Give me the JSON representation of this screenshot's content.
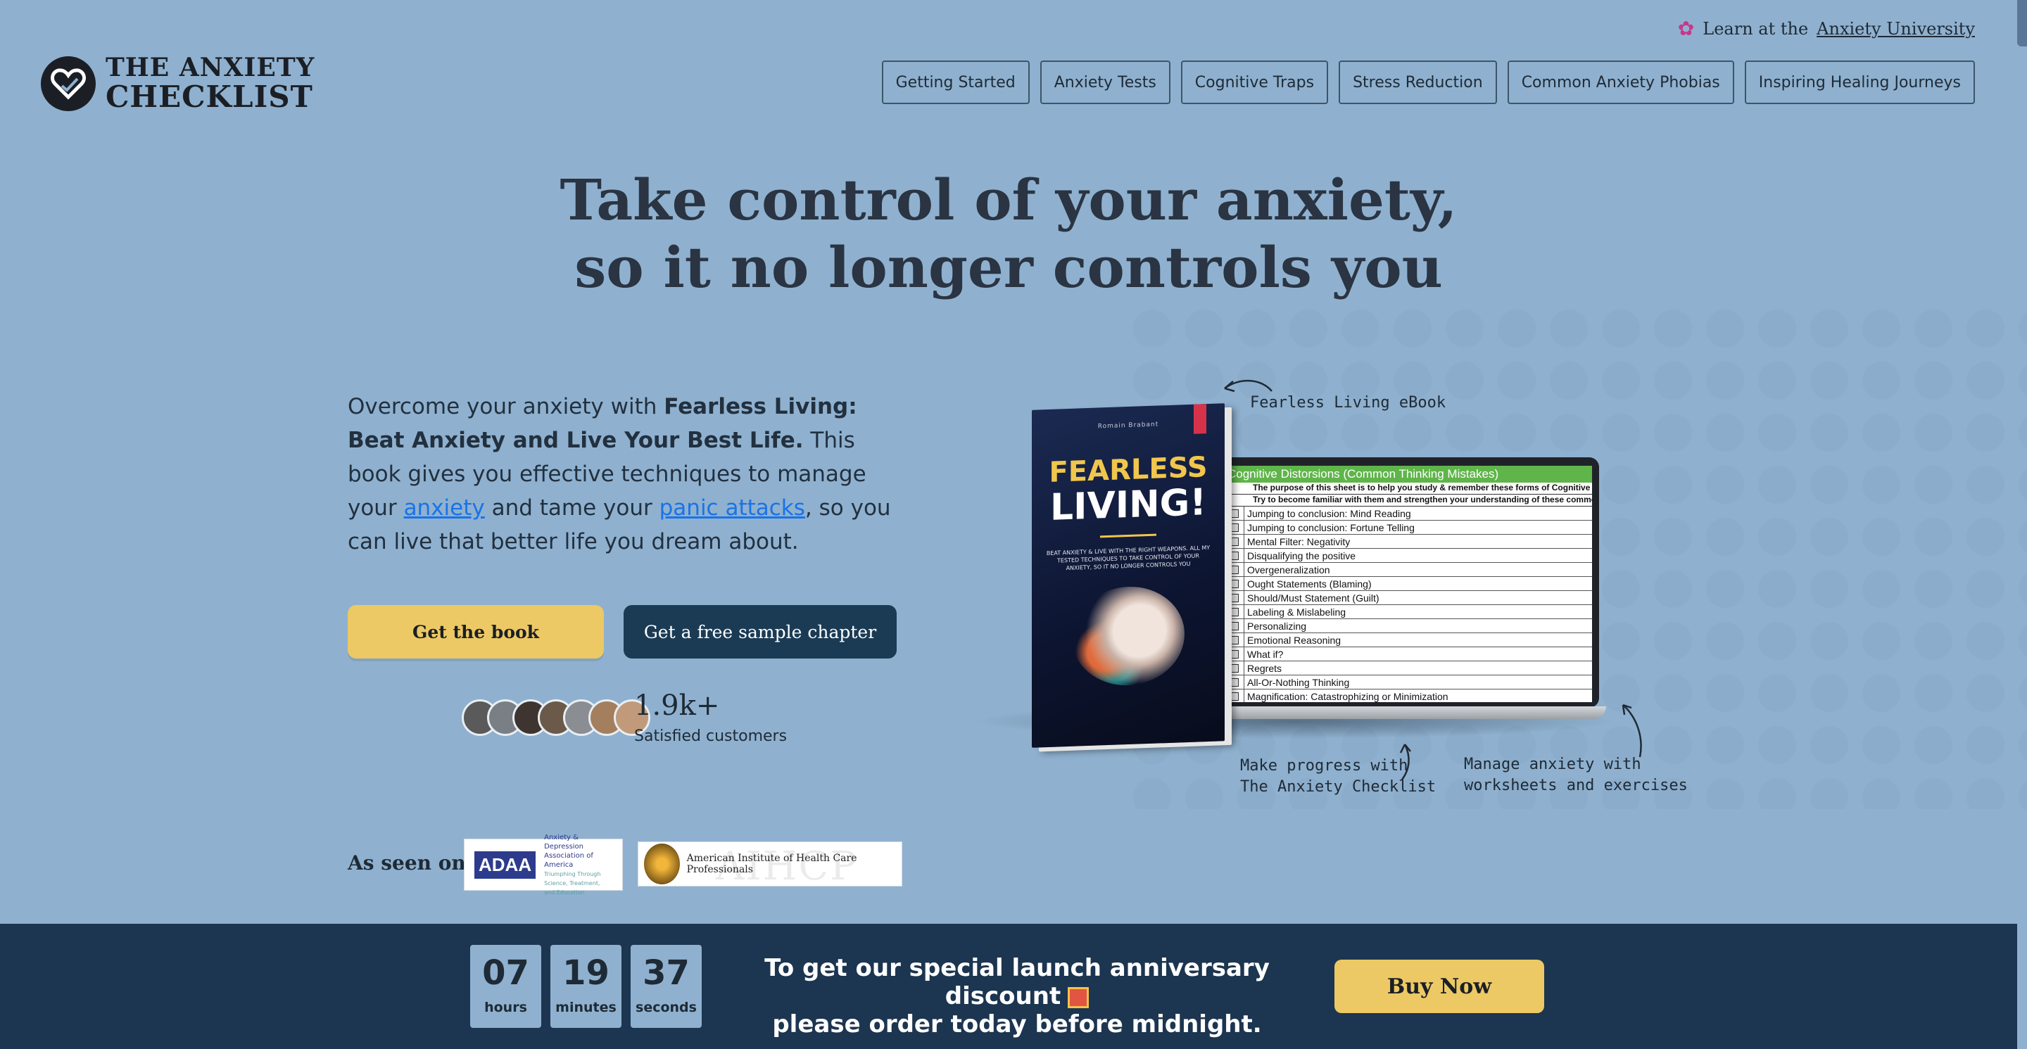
{
  "top_link": {
    "prefix": "Learn at the",
    "link": "Anxiety University",
    "icon": "brain-icon"
  },
  "logo": {
    "line1": "THE ANXIETY",
    "line2": "CHECKLIST",
    "icon": "heart-check-icon"
  },
  "nav": [
    {
      "label": "Getting Started"
    },
    {
      "label": "Anxiety Tests"
    },
    {
      "label": "Cognitive Traps"
    },
    {
      "label": "Stress Reduction"
    },
    {
      "label": "Common Anxiety Phobias"
    },
    {
      "label": "Inspiring Healing Journeys"
    }
  ],
  "hero": {
    "line1": "Take control of your anxiety,",
    "line2": "so it no longer controls you"
  },
  "intro": {
    "p1": "Overcome your anxiety with ",
    "book_title": "Fearless Living: Beat Anxiety and Live Your Best Life.",
    "p2": " This book gives you effective techniques to manage your ",
    "link1": "anxiety",
    "p3": " and tame your ",
    "link2": "panic attacks",
    "p4": ", so you can live that better life you dream about."
  },
  "buttons": {
    "get_book": "Get the book",
    "sample": "Get a free sample chapter",
    "buy_now": "Buy Now"
  },
  "social_proof": {
    "count": "1.9k+",
    "label": "Satisfied customers",
    "avatars": 7
  },
  "as_seen_on": {
    "label": "As seen on:",
    "adaa_mark": "ADAA",
    "adaa_text": "Anxiety & Depression Association of America",
    "adaa_tagline": "Triumphing Through Science, Treatment, and Education",
    "aihcp_ghost": "AIHCP",
    "aihcp_text": "American Institute of Health Care Professionals"
  },
  "book": {
    "author": "Romain Brabant",
    "title1": "FEARLESS",
    "title2": "LIVING!",
    "blurb": "BEAT ANXIETY & LIVE WITH THE RIGHT WEAPONS. ALL MY TESTED TECHNIQUES TO TAKE CONTROL OF YOUR ANXIETY, SO IT NO LONGER CONTROLS YOU"
  },
  "sheet": {
    "header": "Cognitive Distorsions (Common Thinking Mistakes)",
    "sub1": "The purpose of this sheet is to help you study & remember these forms of Cognitive",
    "sub2": "Try to become familiar with them and strengthen your understanding of these common t",
    "rows": [
      "Jumping to conclusion: Mind Reading",
      "Jumping to conclusion: Fortune Telling",
      "Mental Filter: Negativity",
      "Disqualifying the positive",
      "Overgeneralization",
      "Ought Statements (Blaming)",
      "Should/Must Statement (Guilt)",
      "Labeling & Mislabeling",
      "Personalizing",
      "Emotional Reasoning",
      "What if?",
      "Regrets",
      "All-Or-Nothing Thinking",
      "Magnification: Catastrophizing or Minimization"
    ]
  },
  "annotations": {
    "ebook": "Fearless Living eBook",
    "progress1": "Make progress with",
    "progress2": "The Anxiety Checklist",
    "manage1": "Manage anxiety with",
    "manage2": "worksheets and exercises"
  },
  "countdown": [
    {
      "value": "07",
      "unit": "hours"
    },
    {
      "value": "19",
      "unit": "minutes"
    },
    {
      "value": "37",
      "unit": "seconds"
    }
  ],
  "promo": {
    "line1": "To get our special launch anniversary discount",
    "line2": "please order today before midnight.",
    "icon": "gift-icon"
  },
  "colors": {
    "bg": "#8fb1cf",
    "banner": "#1c3550",
    "accent_yellow": "#ecc964",
    "dark_button": "#1b3b55",
    "link": "#1a73e8"
  }
}
